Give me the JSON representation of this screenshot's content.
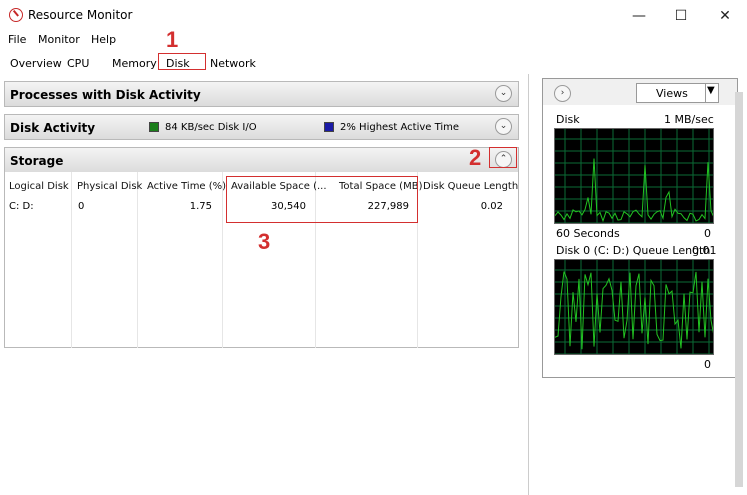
{
  "window": {
    "title": "Resource Monitor",
    "minimize": "—",
    "maximize": "☐",
    "close": "✕"
  },
  "menu": [
    "File",
    "Monitor",
    "Help"
  ],
  "tabs": [
    "Overview",
    "CPU",
    "Memory",
    "Disk",
    "Network"
  ],
  "annotations": {
    "one": "1",
    "two": "2",
    "three": "3"
  },
  "sections": {
    "processes": {
      "title": "Processes with Disk Activity"
    },
    "disk_activity": {
      "title": "Disk Activity",
      "legend1": "84 KB/sec Disk I/O",
      "legend2": "2% Highest Active Time",
      "legend1_color": "#1b7f1b",
      "legend2_color": "#1a1aa6"
    },
    "storage": {
      "title": "Storage"
    }
  },
  "storage_table": {
    "headers": [
      "Logical Disk",
      "Physical Disk",
      "Active Time (%)",
      "Available Space (...",
      "Total Space (MB)",
      "Disk Queue Length"
    ],
    "row": [
      "C: D:",
      "0",
      "1.75",
      "30,540",
      "227,989",
      "0.02"
    ]
  },
  "right": {
    "views_label": "Views",
    "graph1": {
      "title": "Disk",
      "max": "1 MB/sec",
      "footer_left": "60 Seconds",
      "footer_right": "0"
    },
    "graph2": {
      "title": "Disk 0 (C: D:) Queue Length",
      "max": "0.01",
      "footer_right": "0"
    },
    "graph_color": "#22c322"
  }
}
